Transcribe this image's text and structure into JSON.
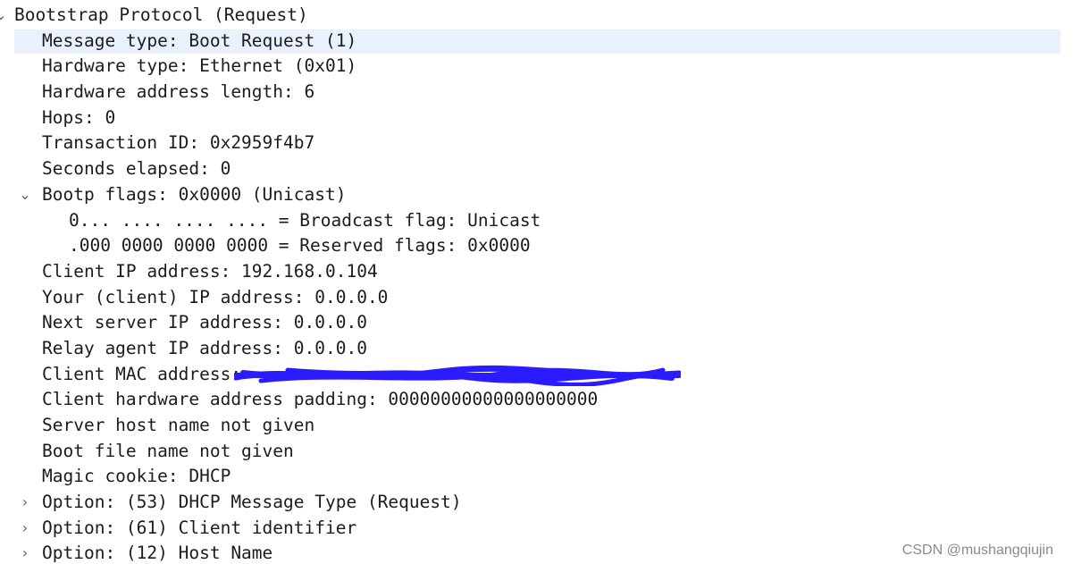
{
  "tree": {
    "root": {
      "label": "Bootstrap Protocol (Request)",
      "expand_icon": "chevron-down-icon"
    },
    "fields": {
      "message_type": "Message type: Boot Request (1)",
      "hardware_type": "Hardware type: Ethernet (0x01)",
      "hardware_address_length": "Hardware address length: 6",
      "hops": "Hops: 0",
      "transaction_id": "Transaction ID: 0x2959f4b7",
      "seconds_elapsed": "Seconds elapsed: 0",
      "bootp_flags": "Bootp flags: 0x0000 (Unicast)",
      "broadcast_flag": "0... .... .... .... = Broadcast flag: Unicast",
      "reserved_flags": ".000 0000 0000 0000 = Reserved flags: 0x0000",
      "client_ip": "Client IP address: 192.168.0.104",
      "your_ip": "Your (client) IP address: 0.0.0.0",
      "next_server_ip": "Next server IP address: 0.0.0.0",
      "relay_agent_ip": "Relay agent IP address: 0.0.0.0",
      "client_mac": "Client MAC address:",
      "client_hw_padding": "Client hardware address padding: 00000000000000000000",
      "server_host_name": "Server host name not given",
      "boot_file_name": "Boot file name not given",
      "magic_cookie": "Magic cookie: DHCP"
    },
    "options": [
      {
        "label": "Option: (53) DHCP Message Type (Request)",
        "expand_icon": "chevron-right-icon"
      },
      {
        "label": "Option: (61) Client identifier",
        "expand_icon": "chevron-right-icon"
      },
      {
        "label": "Option: (12) Host Name",
        "expand_icon": "chevron-right-icon"
      }
    ],
    "selected_row": "message_type"
  },
  "colors": {
    "selection": "#e8f1fc",
    "text": "#1c1c1c",
    "redaction": "#2b1cff",
    "watermark": "#8a8a8a"
  },
  "watermark": "CSDN @mushangqiujin"
}
